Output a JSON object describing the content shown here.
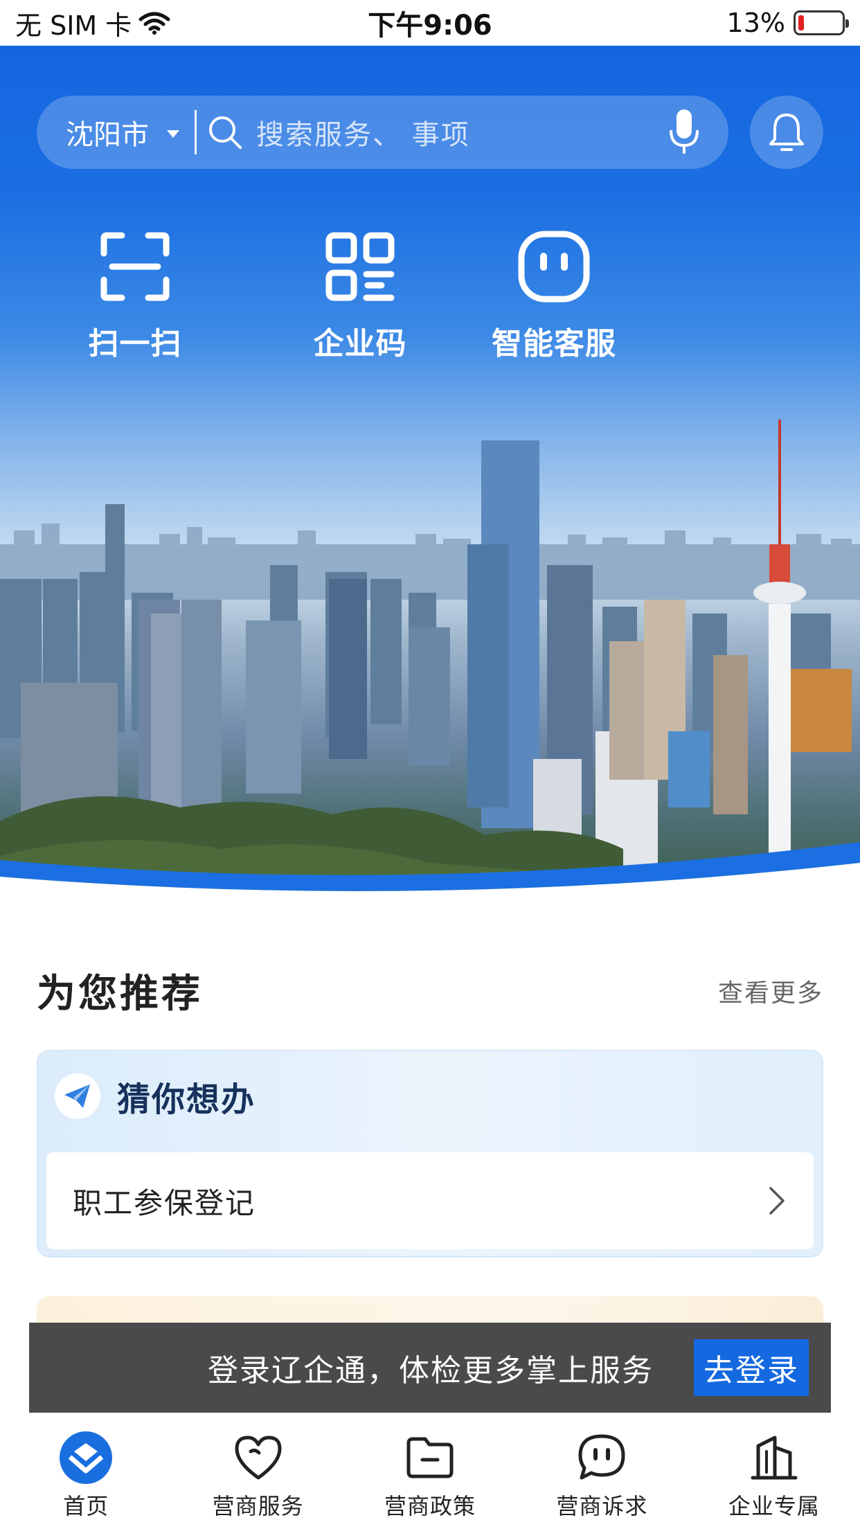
{
  "status_bar": {
    "carrier": "无 SIM 卡",
    "time": "下午9:06",
    "battery": "13%",
    "battery_level": 0.13,
    "battery_color": "#e02020"
  },
  "colors": {
    "brand_blue": "#1469e0",
    "toast_bg": "#4a4a4a"
  },
  "header": {
    "city": "沈阳市",
    "search_placeholder": "搜索服务、 事项",
    "icons": [
      "search-icon",
      "microphone-icon",
      "bell-icon"
    ]
  },
  "quick_actions": [
    {
      "label": "扫一扫",
      "icon": "scan-icon"
    },
    {
      "label": "企业码",
      "icon": "qr-code-icon"
    },
    {
      "label": "智能客服",
      "icon": "robot-icon"
    }
  ],
  "recommend": {
    "title": "为您推荐",
    "more": "查看更多",
    "guess": {
      "title": "猜你想办",
      "icon": "paper-plane-icon",
      "item": "职工参保登记"
    }
  },
  "login_toast": {
    "text": "登录辽企通，体检更多掌上服务",
    "button": "去登录"
  },
  "tabs": [
    {
      "label": "首页",
      "icon": "home-logo-icon",
      "active": true
    },
    {
      "label": "营商服务",
      "icon": "heart-icon",
      "active": false
    },
    {
      "label": "营商政策",
      "icon": "folder-icon",
      "active": false
    },
    {
      "label": "营商诉求",
      "icon": "chat-bubble-icon",
      "active": false
    },
    {
      "label": "企业专属",
      "icon": "building-icon",
      "active": false
    }
  ]
}
